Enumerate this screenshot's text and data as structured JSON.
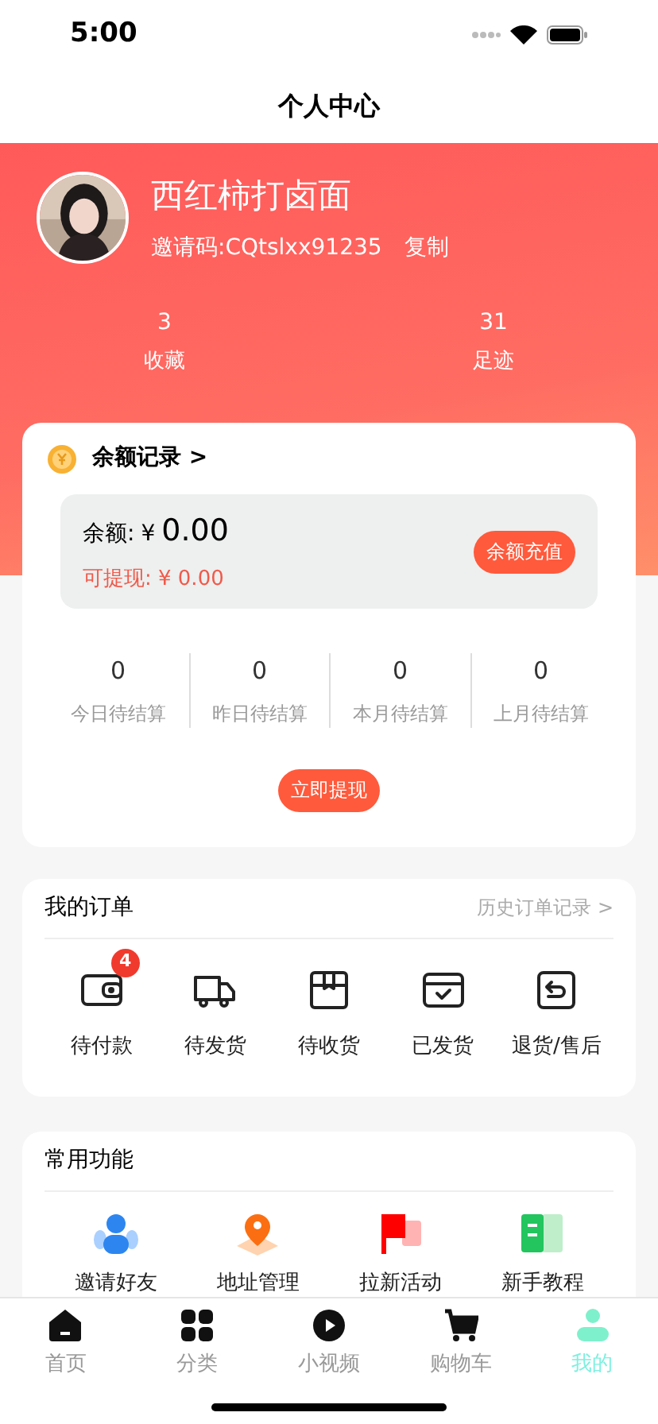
{
  "status_bar": {
    "time": "5:00"
  },
  "nav": {
    "title": "个人中心"
  },
  "profile": {
    "name": "西红柿打卤面",
    "invite_code": "邀请码:CQtslxx91235",
    "copy_label": "复制"
  },
  "stats": [
    {
      "value": "3",
      "label": "收藏"
    },
    {
      "value": "31",
      "label": "足迹"
    }
  ],
  "balance_card": {
    "title": "余额记录 >",
    "balance_label": "余额:",
    "currency": "¥",
    "balance": "0.00",
    "withdrawable": "可提现: ¥ 0.00",
    "recharge_button": "余额充值",
    "pending": [
      {
        "value": "0",
        "label": "今日待结算"
      },
      {
        "value": "0",
        "label": "昨日待结算"
      },
      {
        "value": "0",
        "label": "本月待结算"
      },
      {
        "value": "0",
        "label": "上月待结算"
      }
    ],
    "withdraw_button": "立即提现"
  },
  "orders": {
    "title": "我的订单",
    "history_link": "历史订单记录 >",
    "items": [
      {
        "kind": "wallet",
        "label": "待付款",
        "badge": "4"
      },
      {
        "kind": "truck",
        "label": "待发货"
      },
      {
        "kind": "package",
        "label": "待收货"
      },
      {
        "kind": "shipped",
        "label": "已发货"
      },
      {
        "kind": "return",
        "label": "退货/售后"
      }
    ]
  },
  "functions": {
    "title": "常用功能",
    "items": [
      {
        "kind": "invite",
        "label": "邀请好友"
      },
      {
        "kind": "address",
        "label": "地址管理"
      },
      {
        "kind": "campaign",
        "label": "拉新活动"
      },
      {
        "kind": "tutorial",
        "label": "新手教程"
      }
    ]
  },
  "tab_bar": [
    {
      "kind": "home",
      "label": "首页",
      "selected": false
    },
    {
      "kind": "category",
      "label": "分类",
      "selected": false
    },
    {
      "kind": "video",
      "label": "小视频",
      "selected": false
    },
    {
      "kind": "cart",
      "label": "购物车",
      "selected": false
    },
    {
      "kind": "me",
      "label": "我的",
      "selected": true
    }
  ]
}
